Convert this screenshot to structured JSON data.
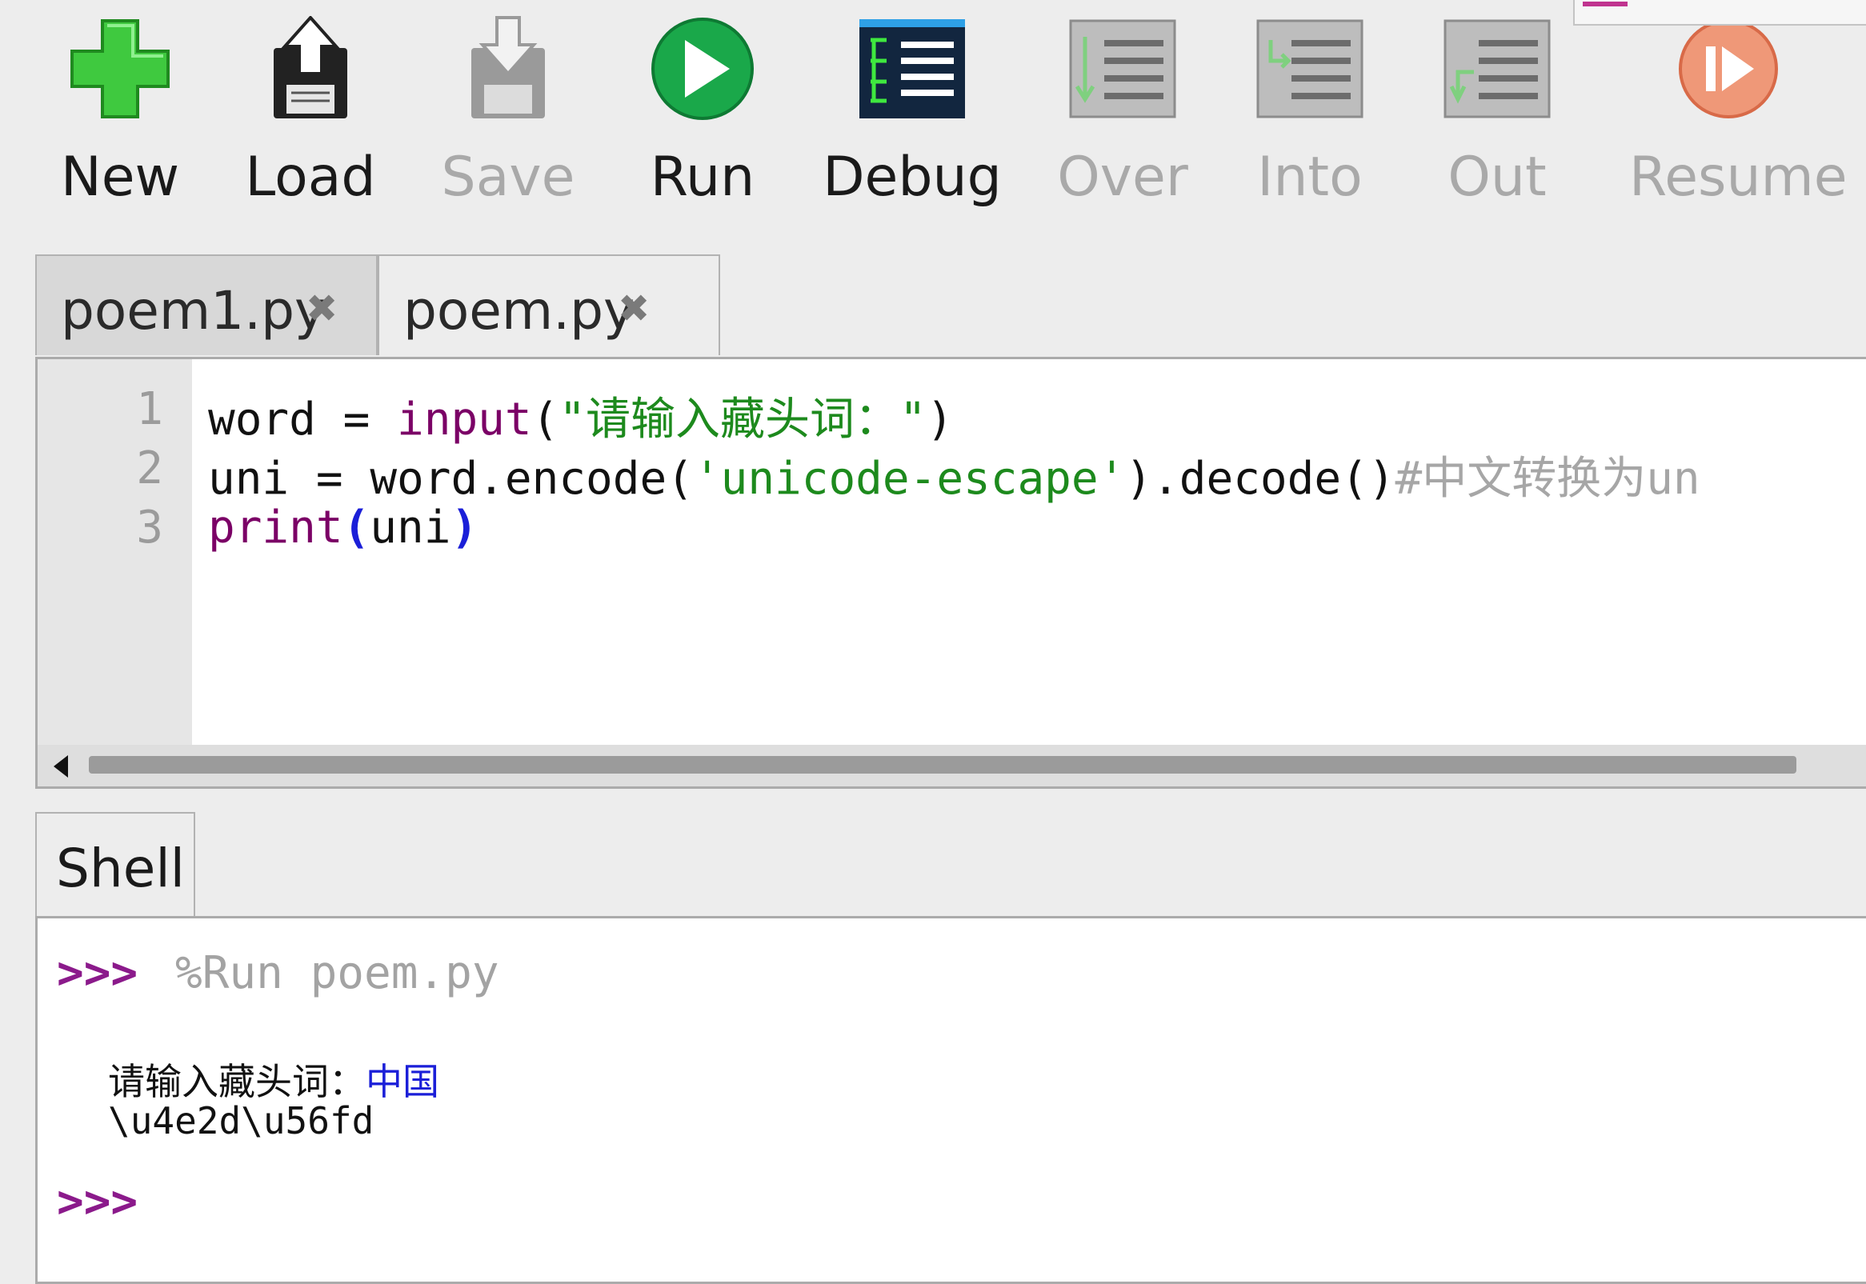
{
  "toolbar": {
    "buttons": [
      {
        "label": "New",
        "icon": "new-file-plus-icon",
        "enabled": true
      },
      {
        "label": "Load",
        "icon": "load-floppy-icon",
        "enabled": true
      },
      {
        "label": "Save",
        "icon": "save-floppy-icon",
        "enabled": false
      },
      {
        "label": "Run",
        "icon": "run-play-icon",
        "enabled": true
      },
      {
        "label": "Debug",
        "icon": "debug-icon",
        "enabled": true
      },
      {
        "label": "Over",
        "icon": "step-over-icon",
        "enabled": false
      },
      {
        "label": "Into",
        "icon": "step-into-icon",
        "enabled": false
      },
      {
        "label": "Out",
        "icon": "step-out-icon",
        "enabled": false
      },
      {
        "label": "Resume",
        "icon": "resume-icon",
        "enabled": false
      }
    ]
  },
  "editor": {
    "tabs": [
      {
        "label": "poem1.py",
        "active": false
      },
      {
        "label": "poem.py",
        "active": true
      }
    ],
    "close_glyph": "✖",
    "line_numbers": [
      "1",
      "2",
      "3"
    ],
    "lines": {
      "l1": {
        "var": "word",
        "op": " = ",
        "fn": "input",
        "open": "(",
        "str": "\"请输入藏头词：\"",
        "close": ")"
      },
      "l2": {
        "var": "uni",
        "op": " = ",
        "mid": "word.encode(",
        "str": "'unicode-escape'",
        "after": ").decode()",
        "comment": "#中文转换为un"
      },
      "l3": {
        "fn": "print",
        "open": "(",
        "arg": "uni",
        "close": ")"
      }
    }
  },
  "shell": {
    "tab_label": "Shell",
    "prompt": ">>>",
    "command": "%Run poem.py",
    "input_prompt": "请输入藏头词：",
    "input_value": "中国",
    "output": "\\u4e2d\\u56fd"
  },
  "colors": {
    "keyword_builtin": "#7b0066",
    "string": "#1d8a1d",
    "comment": "#a6a6a6",
    "prompt": "#8b1a8b",
    "user_input": "#1b1fd8"
  }
}
